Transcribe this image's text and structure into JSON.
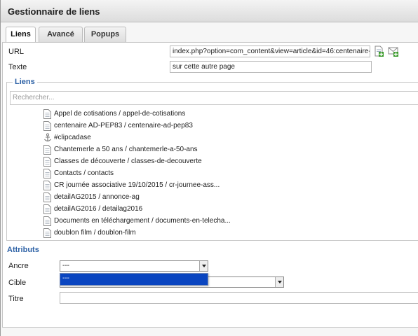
{
  "window": {
    "title": "Gestionnaire de liens"
  },
  "tabs": [
    {
      "label": "Liens",
      "active": true
    },
    {
      "label": "Avancé",
      "active": false
    },
    {
      "label": "Popups",
      "active": false
    }
  ],
  "form": {
    "url_label": "URL",
    "url_value": "index.php?option=com_content&view=article&id=46:centenaire-a",
    "text_label": "Texte",
    "text_value": "sur cette autre page"
  },
  "links": {
    "legend": "Liens",
    "search_placeholder": "Rechercher...",
    "items": [
      {
        "label": "Appel de cotisations / appel-de-cotisations",
        "icon": "page-icon"
      },
      {
        "label": "centenaire AD-PEP83 / centenaire-ad-pep83",
        "icon": "page-icon"
      },
      {
        "label": "#clipcadase",
        "icon": "anchor-icon"
      },
      {
        "label": "Chantemerle a 50 ans / chantemerle-a-50-ans",
        "icon": "page-icon"
      },
      {
        "label": "Classes de découverte / classes-de-decouverte",
        "icon": "page-icon"
      },
      {
        "label": "Contacts / contacts",
        "icon": "page-icon"
      },
      {
        "label": "CR journée associative 19/10/2015 / cr-journee-ass...",
        "icon": "page-icon"
      },
      {
        "label": "detailAG2015 / annonce-ag",
        "icon": "page-icon"
      },
      {
        "label": "detailAG2016 / detailag2016",
        "icon": "page-icon"
      },
      {
        "label": "Documents en téléchargement / documents-en-telecha...",
        "icon": "page-icon"
      },
      {
        "label": "doublon film / doublon-film",
        "icon": "page-icon"
      }
    ]
  },
  "attributes": {
    "legend": "Attributs",
    "ancre_label": "Ancre",
    "ancre_value": "---",
    "cible_label": "Cible",
    "titre_label": "Titre",
    "dropdown_option": "---"
  },
  "colors": {
    "accent": "#2e62a6",
    "selection": "#0a45c0"
  }
}
